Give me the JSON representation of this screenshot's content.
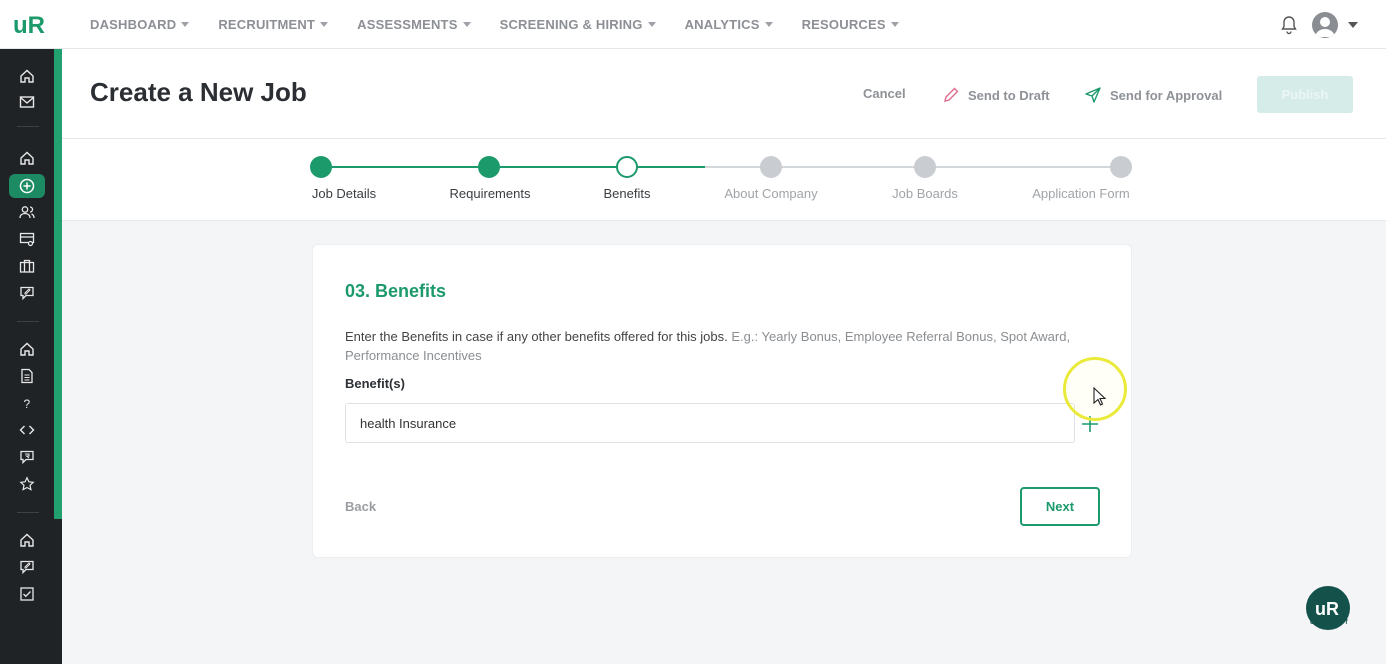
{
  "brand": {
    "logo_text": "uR",
    "primary_color": "#1c9a6c",
    "sidebar_color": "#1f2326"
  },
  "nav": {
    "items": [
      {
        "label": "DASHBOARD"
      },
      {
        "label": "RECRUITMENT"
      },
      {
        "label": "ASSESSMENTS"
      },
      {
        "label": "SCREENING & HIRING"
      },
      {
        "label": "ANALYTICS"
      },
      {
        "label": "RESOURCES"
      }
    ]
  },
  "header": {
    "title": "Create a New Job",
    "cancel_label": "Cancel",
    "draft_label": "Send to Draft",
    "approval_label": "Send for Approval",
    "publish_label": "Publish"
  },
  "stepper": {
    "steps": [
      {
        "label": "Job Details",
        "state": "done"
      },
      {
        "label": "Requirements",
        "state": "done"
      },
      {
        "label": "Benefits",
        "state": "current"
      },
      {
        "label": "About Company",
        "state": "todo"
      },
      {
        "label": "Job Boards",
        "state": "todo"
      },
      {
        "label": "Application Form",
        "state": "todo"
      }
    ]
  },
  "card": {
    "title": "03. Benefits",
    "description_main": "Enter the Benefits in case if any other benefits offered for this jobs.",
    "description_example": "E.g.: Yearly Bonus, Employee Referral Bonus, Spot Award, Performance Incentives",
    "field_label": "Benefit(s)",
    "benefit_value": "health Insurance",
    "back_label": "Back",
    "next_label": "Next"
  },
  "agent": {
    "logo_text": "uR",
    "caption": "UR AGENT"
  }
}
